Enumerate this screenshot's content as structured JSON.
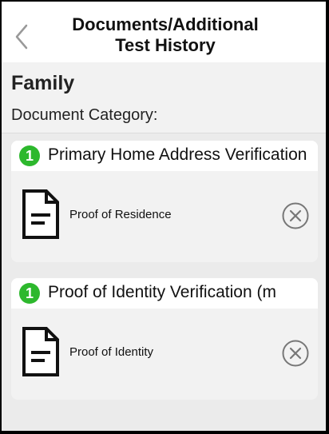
{
  "header": {
    "title_line1": "Documents/Additional",
    "title_line2": "Test History",
    "back_icon": "chevron-left-icon"
  },
  "section": {
    "name": "Family",
    "category_label": "Document Category:"
  },
  "categories": [
    {
      "badge": "1",
      "title": "Primary Home Address Verification",
      "document": {
        "label": "Proof of Residence",
        "icon": "document-icon",
        "remove_icon": "remove-circle-x-icon"
      }
    },
    {
      "badge": "1",
      "title": "Proof of Identity Verification (m",
      "document": {
        "label": "Proof of Identity",
        "icon": "document-icon",
        "remove_icon": "remove-circle-x-icon"
      }
    }
  ],
  "colors": {
    "badge_green": "#2db82d",
    "background": "#ebebeb",
    "card": "#f2f2f2"
  }
}
